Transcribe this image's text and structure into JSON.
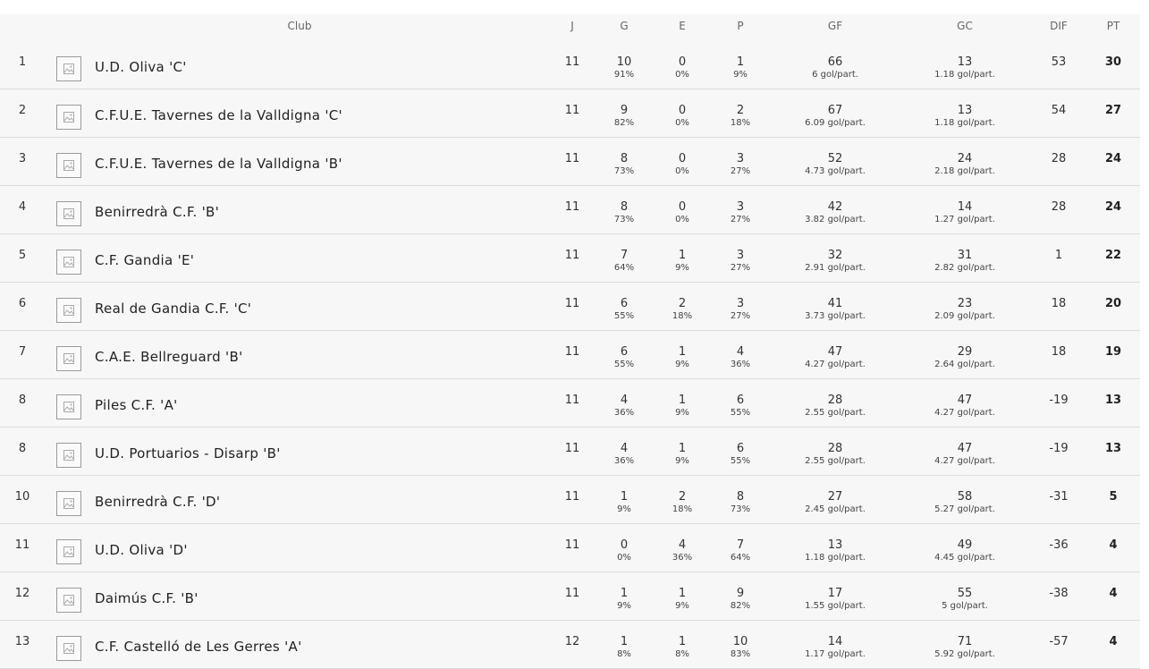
{
  "headers": {
    "club": "Club",
    "j": "J",
    "g": "G",
    "e": "E",
    "p": "P",
    "gf": "GF",
    "gc": "GC",
    "dif": "DIF",
    "pt": "PT"
  },
  "rows": [
    {
      "pos": "1",
      "club": "U.D. Oliva 'C'",
      "j": "11",
      "g": "10",
      "g_pct": "91%",
      "e": "0",
      "e_pct": "0%",
      "p": "1",
      "p_pct": "9%",
      "gf": "66",
      "gf_avg": "6 gol/part.",
      "gc": "13",
      "gc_avg": "1.18 gol/part.",
      "dif": "53",
      "pt": "30"
    },
    {
      "pos": "2",
      "club": "C.F.U.E. Tavernes de la Valldigna 'C'",
      "j": "11",
      "g": "9",
      "g_pct": "82%",
      "e": "0",
      "e_pct": "0%",
      "p": "2",
      "p_pct": "18%",
      "gf": "67",
      "gf_avg": "6.09 gol/part.",
      "gc": "13",
      "gc_avg": "1.18 gol/part.",
      "dif": "54",
      "pt": "27"
    },
    {
      "pos": "3",
      "club": "C.F.U.E. Tavernes de la Valldigna 'B'",
      "j": "11",
      "g": "8",
      "g_pct": "73%",
      "e": "0",
      "e_pct": "0%",
      "p": "3",
      "p_pct": "27%",
      "gf": "52",
      "gf_avg": "4.73 gol/part.",
      "gc": "24",
      "gc_avg": "2.18 gol/part.",
      "dif": "28",
      "pt": "24"
    },
    {
      "pos": "4",
      "club": "Benirredrà C.F. 'B'",
      "j": "11",
      "g": "8",
      "g_pct": "73%",
      "e": "0",
      "e_pct": "0%",
      "p": "3",
      "p_pct": "27%",
      "gf": "42",
      "gf_avg": "3.82 gol/part.",
      "gc": "14",
      "gc_avg": "1.27 gol/part.",
      "dif": "28",
      "pt": "24"
    },
    {
      "pos": "5",
      "club": "C.F. Gandia 'E'",
      "j": "11",
      "g": "7",
      "g_pct": "64%",
      "e": "1",
      "e_pct": "9%",
      "p": "3",
      "p_pct": "27%",
      "gf": "32",
      "gf_avg": "2.91 gol/part.",
      "gc": "31",
      "gc_avg": "2.82 gol/part.",
      "dif": "1",
      "pt": "22"
    },
    {
      "pos": "6",
      "club": "Real de Gandia C.F. 'C'",
      "j": "11",
      "g": "6",
      "g_pct": "55%",
      "e": "2",
      "e_pct": "18%",
      "p": "3",
      "p_pct": "27%",
      "gf": "41",
      "gf_avg": "3.73 gol/part.",
      "gc": "23",
      "gc_avg": "2.09 gol/part.",
      "dif": "18",
      "pt": "20"
    },
    {
      "pos": "7",
      "club": "C.A.E. Bellreguard 'B'",
      "j": "11",
      "g": "6",
      "g_pct": "55%",
      "e": "1",
      "e_pct": "9%",
      "p": "4",
      "p_pct": "36%",
      "gf": "47",
      "gf_avg": "4.27 gol/part.",
      "gc": "29",
      "gc_avg": "2.64 gol/part.",
      "dif": "18",
      "pt": "19"
    },
    {
      "pos": "8",
      "club": "Piles C.F. 'A'",
      "j": "11",
      "g": "4",
      "g_pct": "36%",
      "e": "1",
      "e_pct": "9%",
      "p": "6",
      "p_pct": "55%",
      "gf": "28",
      "gf_avg": "2.55 gol/part.",
      "gc": "47",
      "gc_avg": "4.27 gol/part.",
      "dif": "-19",
      "pt": "13"
    },
    {
      "pos": "8",
      "club": "U.D. Portuarios - Disarp 'B'",
      "j": "11",
      "g": "4",
      "g_pct": "36%",
      "e": "1",
      "e_pct": "9%",
      "p": "6",
      "p_pct": "55%",
      "gf": "28",
      "gf_avg": "2.55 gol/part.",
      "gc": "47",
      "gc_avg": "4.27 gol/part.",
      "dif": "-19",
      "pt": "13"
    },
    {
      "pos": "10",
      "club": "Benirredrà C.F. 'D'",
      "j": "11",
      "g": "1",
      "g_pct": "9%",
      "e": "2",
      "e_pct": "18%",
      "p": "8",
      "p_pct": "73%",
      "gf": "27",
      "gf_avg": "2.45 gol/part.",
      "gc": "58",
      "gc_avg": "5.27 gol/part.",
      "dif": "-31",
      "pt": "5"
    },
    {
      "pos": "11",
      "club": "U.D. Oliva 'D'",
      "j": "11",
      "g": "0",
      "g_pct": "0%",
      "e": "4",
      "e_pct": "36%",
      "p": "7",
      "p_pct": "64%",
      "gf": "13",
      "gf_avg": "1.18 gol/part.",
      "gc": "49",
      "gc_avg": "4.45 gol/part.",
      "dif": "-36",
      "pt": "4"
    },
    {
      "pos": "12",
      "club": "Daimús C.F. 'B'",
      "j": "11",
      "g": "1",
      "g_pct": "9%",
      "e": "1",
      "e_pct": "9%",
      "p": "9",
      "p_pct": "82%",
      "gf": "17",
      "gf_avg": "1.55 gol/part.",
      "gc": "55",
      "gc_avg": "5 gol/part.",
      "dif": "-38",
      "pt": "4"
    },
    {
      "pos": "13",
      "club": "C.F. Castelló de Les Gerres 'A'",
      "j": "12",
      "g": "1",
      "g_pct": "8%",
      "e": "1",
      "e_pct": "8%",
      "p": "10",
      "p_pct": "83%",
      "gf": "14",
      "gf_avg": "1.17 gol/part.",
      "gc": "71",
      "gc_avg": "5.92 gol/part.",
      "dif": "-57",
      "pt": "4"
    }
  ]
}
